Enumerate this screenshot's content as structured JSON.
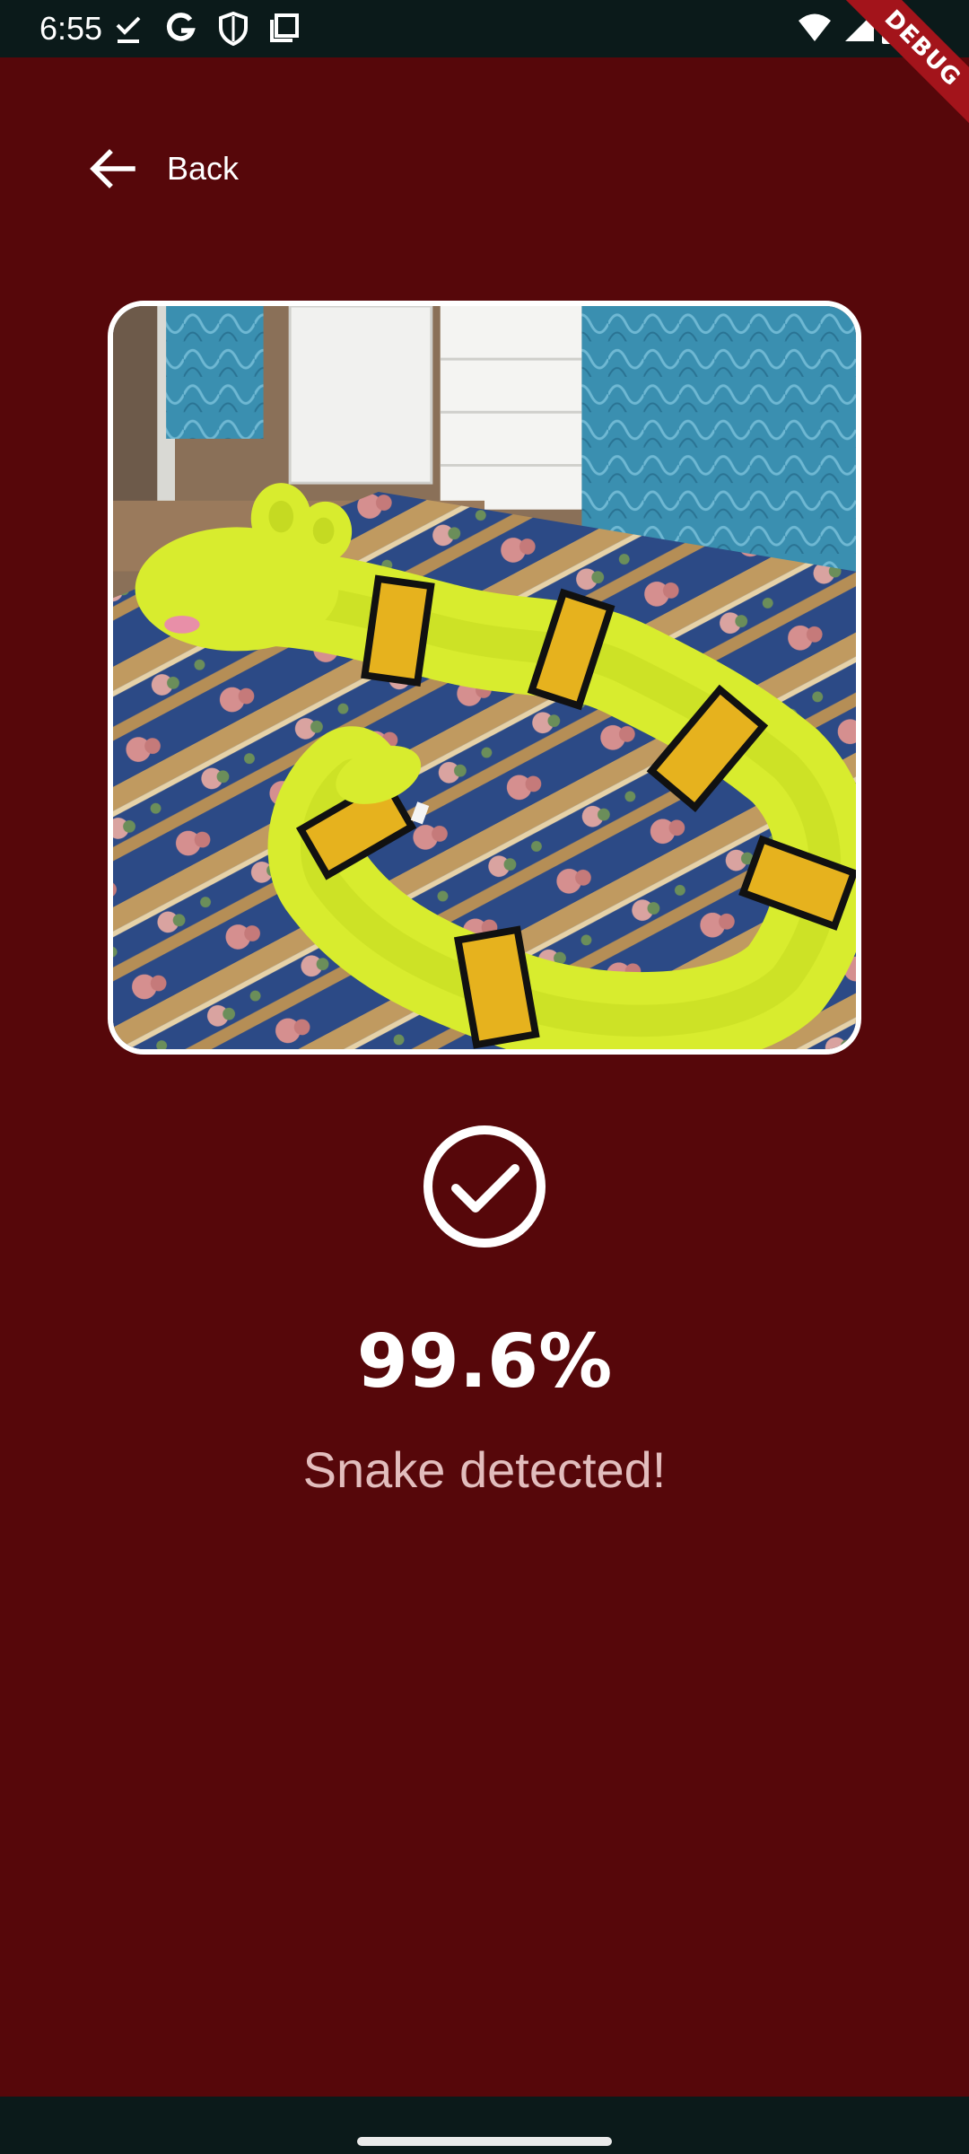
{
  "status_bar": {
    "time": "6:55",
    "left_icons": [
      "check-icon",
      "google-g-icon",
      "shield-icon",
      "screenshot-icon"
    ],
    "right_icons": [
      "wifi-icon",
      "signal-icon",
      "battery-icon"
    ]
  },
  "debug_banner": "DEBUG",
  "header": {
    "back_label": "Back",
    "back_icon": "arrow-left-icon"
  },
  "result": {
    "image_subject": "Plush toy snake lying on a quilted bed cover",
    "icon": "check-circle-icon",
    "confidence": "99.6%",
    "message": "Snake detected!"
  },
  "colors": {
    "background": "#56070a",
    "system_bars": "#0b1a1a",
    "primary_text": "#ffffff",
    "secondary_text": "#e2bdbd",
    "debug_ribbon": "#a3141b"
  }
}
